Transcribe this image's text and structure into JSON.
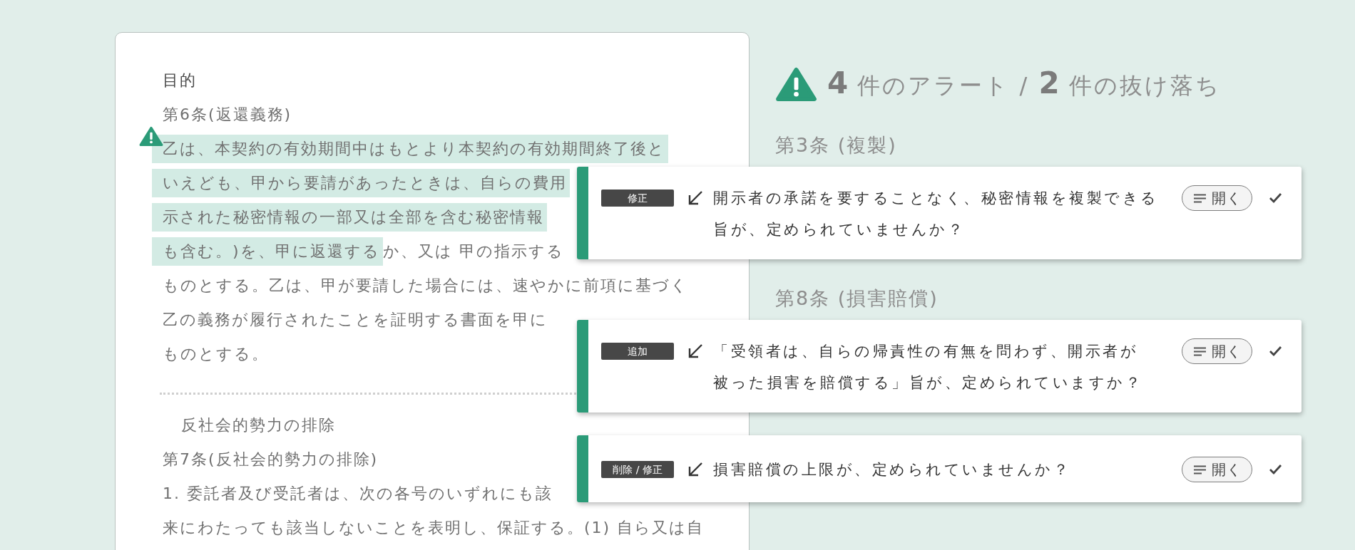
{
  "document": {
    "blocks": [
      {
        "kind": "heading",
        "text": "目的"
      },
      {
        "kind": "article",
        "text": "第6条(返還義務)"
      },
      {
        "kind": "paragraph",
        "alert": true,
        "lines": [
          [
            {
              "text": "乙は、本契約の有効期間中はもとより本契約の有効期間終了後と",
              "highlighted": true
            }
          ],
          [
            {
              "text": "いえども、甲から要請があったときは、自らの費用",
              "highlighted": true
            }
          ],
          [
            {
              "text": "示された秘密情報の一部又は全部を含む秘密情報",
              "highlighted": true
            }
          ],
          [
            {
              "text": "も含む。)を、甲に返還する",
              "highlighted": true
            },
            {
              "text": "か、又は 甲の指示する",
              "highlighted": false
            }
          ],
          [
            {
              "text": "ものとする。乙は、甲が要請した場合には、速やかに前項に基づく",
              "highlighted": false
            }
          ],
          [
            {
              "text": "乙の義務が履行されたことを証明する書面を甲に",
              "highlighted": false
            }
          ],
          [
            {
              "text": "ものとする。",
              "highlighted": false
            }
          ]
        ]
      },
      {
        "kind": "divider"
      },
      {
        "kind": "subheading",
        "text": "反社会的勢力の排除"
      },
      {
        "kind": "article",
        "text": "第7条(反社会的勢力の排除)"
      },
      {
        "kind": "paragraph",
        "alert": false,
        "lines": [
          [
            {
              "text": "1. 委託者及び受託者は、次の各号のいずれにも該",
              "highlighted": false
            }
          ],
          [
            {
              "text": "来にわたっても該当しないことを表明し、保証する。(1) 自ら又は自",
              "highlighted": false
            }
          ]
        ]
      }
    ]
  },
  "summary": {
    "text": "**4** 件のアラート / **2** 件の抜け落ち"
  },
  "sections": [
    {
      "heading": "第3条 (複製)",
      "alerts": [
        {
          "tag": "修正",
          "message": "開示者の承諾を要することなく、秘密情報を複製できる旨が、定められていませんか？",
          "button": "開く"
        }
      ]
    },
    {
      "heading": "第8条 (損害賠償)",
      "alerts": [
        {
          "tag": "追加",
          "message": "「受領者は、自らの帰責性の有無を問わず、開示者が被った損害を賠償する」旨が、定められていますか？",
          "button": "開く"
        },
        {
          "tag": "削除 / 修正",
          "message": "損害賠償の上限が、定められていませんか？",
          "button": "開く"
        }
      ]
    }
  ]
}
